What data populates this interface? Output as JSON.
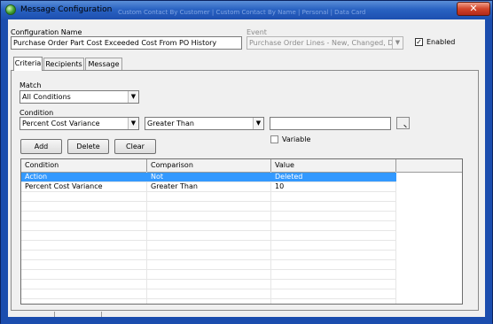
{
  "window": {
    "title": "Message Configuration",
    "ghost_title": "Custom Contact By Customer | Custom Contact By Name | Personal | Data Card",
    "close_glyph": "✕"
  },
  "config": {
    "name_label": "Configuration Name",
    "name_value": "Purchase Order Part Cost Exceeded Cost From PO History",
    "event_label": "Event",
    "event_value": "Purchase Order Lines - New, Changed, Delete",
    "enabled_label": "Enabled",
    "enabled_checked": "✓"
  },
  "tabs": [
    {
      "label": "Criteria"
    },
    {
      "label": "Recipients"
    },
    {
      "label": "Message"
    }
  ],
  "criteria": {
    "match_label": "Match",
    "match_value": "All Conditions",
    "condition_label": "Condition",
    "condition_field_value": "Percent Cost Variance",
    "comparison_value": "Greater Than",
    "value_input": "",
    "variable_label": "Variable",
    "buttons": {
      "add": "Add",
      "delete": "Delete",
      "clear": "Clear"
    }
  },
  "grid": {
    "columns": [
      "Condition",
      "Comparison",
      "Value"
    ],
    "rows": [
      {
        "condition": "Action",
        "comparison": "Not",
        "value": "Deleted",
        "selected": true
      },
      {
        "condition": "Percent Cost Variance",
        "comparison": "Greater Than",
        "value": "10",
        "selected": false
      }
    ]
  },
  "icons": {
    "app": "app-globe-icon",
    "close": "close-icon",
    "dropdown": "chevron-down-icon",
    "ellipsis": "ellipsis-icon"
  },
  "colors": {
    "selection": "#3399ff",
    "frame": "#1b4dae",
    "close": "#d2452a"
  }
}
